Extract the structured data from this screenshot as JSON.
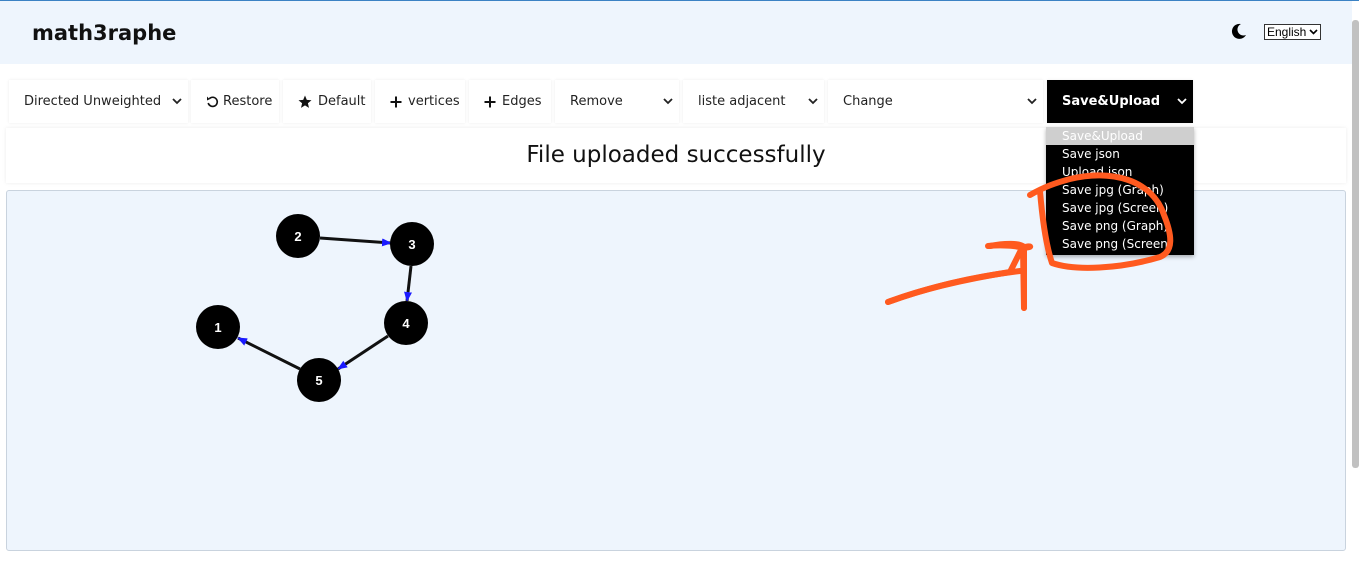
{
  "app": {
    "title": "math3raphe"
  },
  "header": {
    "language": "English",
    "theme_icon": "moon-icon"
  },
  "toolbar": {
    "graph_type": "Directed Unweighted",
    "restore": "Restore",
    "default": "Default",
    "vertices": "vertices",
    "edges": "Edges",
    "remove": "Remove",
    "liste": "liste adjacent",
    "change": "Change",
    "save_upload": "Save&Upload"
  },
  "status": {
    "message": "File uploaded successfully"
  },
  "dropdown": {
    "options": [
      "Save&Upload",
      "Save json",
      "Upload json",
      "Save jpg (Graph)",
      "Save jpg (Screen)",
      "Save png (Graph)",
      "Save png (Screen)"
    ],
    "selected": "Save&Upload"
  },
  "graph": {
    "nodes": [
      "1",
      "2",
      "3",
      "4",
      "5"
    ],
    "edges": [
      [
        "2",
        "3"
      ],
      [
        "3",
        "4"
      ],
      [
        "4",
        "5"
      ],
      [
        "5",
        "1"
      ]
    ],
    "node_color": "#000000",
    "arrow_color": "#1a1aff"
  },
  "colors": {
    "accent": "#000000",
    "annotation": "#ff5a1f",
    "canvas_bg": "#eef5fd"
  }
}
